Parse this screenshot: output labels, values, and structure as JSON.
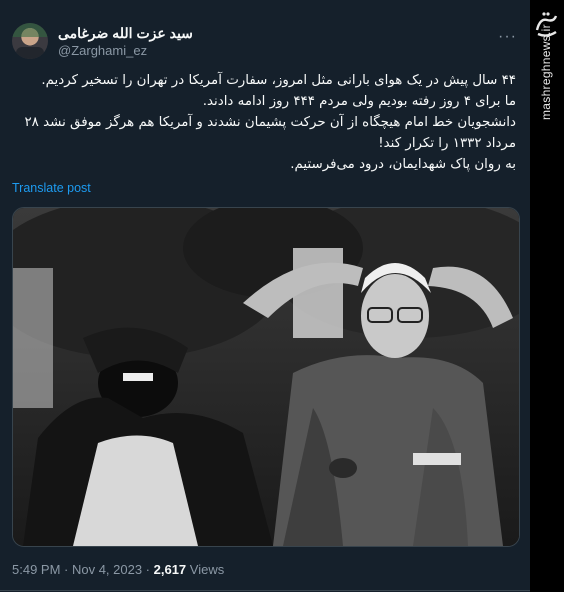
{
  "tweet": {
    "author_name": "سید عزت الله ضرغامی",
    "author_handle": "@Zarghami_ez",
    "more_icon": "more-icon",
    "body_lines": [
      "۴۴ سال پیش در یک هوای بارانی مثل امروز، سفارت آمریکا در تهران را تسخیر کردیم.",
      "ما برای ۴ روز رفته بودیم ولی مردم ۴۴۴ روز ادامه دادند.",
      "دانشجویان خط امام هیچگاه از آن حرکت پشیمان نشدند و آمریکا هم هرگز موفق نشد ۲۸ مرداد ۱۳۳۲ را تکرار کند!",
      "به روان پاک شهدایمان، درود می‌فرستیم."
    ],
    "translate_label": "Translate post",
    "timestamp": "5:49 PM · Nov 4, 2023 · ",
    "views_count": "2,617",
    "views_label": " Views"
  },
  "watermark": {
    "logo_text": "مشرق",
    "site": "mashreghnews.ir"
  },
  "colors": {
    "background": "#15202b",
    "text": "#f7f9f9",
    "secondary": "#8b98a5",
    "link": "#1d9bf0",
    "border": "#38444d"
  }
}
